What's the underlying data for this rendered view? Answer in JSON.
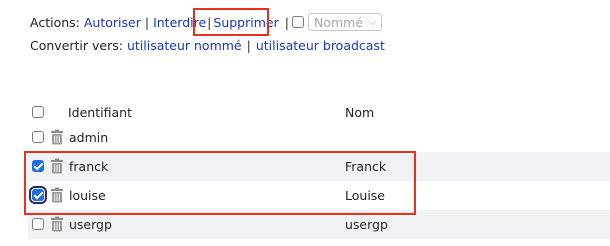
{
  "actions": {
    "label": "Actions:",
    "links": [
      "Autoriser",
      "Interdire",
      "Supprimer"
    ],
    "separator": "|",
    "filter_select": {
      "value": "Nommé"
    }
  },
  "convert": {
    "label": "Convertir vers:",
    "links": [
      "utilisateur nommé",
      "utilisateur broadcast"
    ]
  },
  "table": {
    "headers": {
      "identifiant": "Identifiant",
      "nom": "Nom"
    },
    "rows": [
      {
        "identifiant": "admin",
        "nom": "",
        "checked": false
      },
      {
        "identifiant": "franck",
        "nom": "Franck",
        "checked": true
      },
      {
        "identifiant": "louise",
        "nom": "Louise",
        "checked": true
      },
      {
        "identifiant": "usergp",
        "nom": "usergp",
        "checked": false
      }
    ]
  },
  "colors": {
    "link": "#1a35c4",
    "highlight": "#e8321d",
    "checkbox_checked": "#1f6ee0",
    "row_alt": "#f0f2f6"
  },
  "icons": {
    "row_action": "trash-icon",
    "select_chevron": "chevron-down-icon"
  }
}
